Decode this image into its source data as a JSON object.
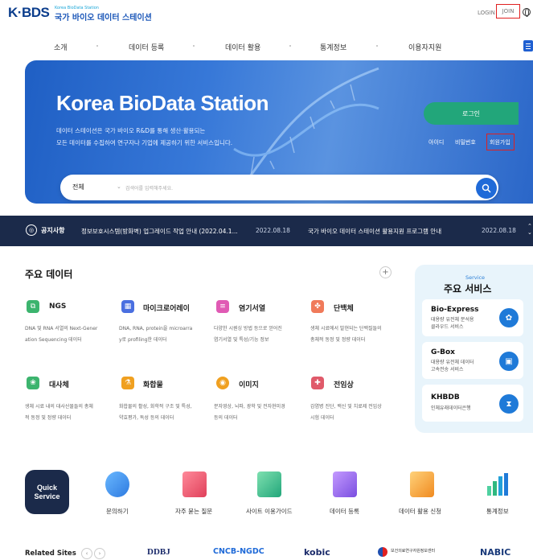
{
  "header": {
    "logo_text": "K·BDS",
    "logo_sub": "Korea BioData Station",
    "logo_name": "국가 바이오 데이터 스테이션",
    "login": "LOGIN",
    "join": "JOIN"
  },
  "nav": [
    "소개",
    "데이터 등록",
    "데이터 활용",
    "통계정보",
    "이용자지원"
  ],
  "hero": {
    "title": "Korea BioData Station",
    "desc_line1": "데이터 스테이션은 국가 바이오 R&D를 통해 생산·활용되는",
    "desc_line2": "모든 데이터를 수집하여 연구자나 기업에 제공하기 위한 서비스입니다.",
    "login_button": "로그인",
    "find_id": "아이디",
    "find_pw": "비밀번호",
    "signup": "회원가입"
  },
  "search": {
    "category": "전체",
    "placeholder": "검색어를 입력해주세요."
  },
  "notice": {
    "label": "공지사항",
    "items": [
      {
        "text": "정보보호시스템(방화벽) 업그레이드 작업 안내 (2022.04.1...",
        "date": "2022.08.18"
      },
      {
        "text": "국가 바이오 데이터 스테이션 활용지원 프로그램 안내",
        "date": "2022.08.18"
      }
    ]
  },
  "main_data": {
    "title": "주요 데이터",
    "items": [
      {
        "name": "NGS",
        "desc1": "DNA 및 RNA 서열의 Next-Gener",
        "desc2": "ation Sequencing 데이터",
        "color": "#3cb46e"
      },
      {
        "name": "마이크로어레이",
        "desc1": "DNA, RNA, protein을 microarra",
        "desc2": "y로 profiling한 데이터",
        "color": "#4a6fe0"
      },
      {
        "name": "염기서열",
        "desc1": "다양한 시퀀싱 방법 등으로 얻어진",
        "desc2": "염기서열 및 특성/기능 정보",
        "color": "#e05ab4"
      },
      {
        "name": "단백체",
        "desc1": "생체 시료에서 발현되는 단백질들의",
        "desc2": "총체적 동정 및 정량 데이터",
        "color": "#f07a5a"
      },
      {
        "name": "대사체",
        "desc1": "생체 시료 내의 대사산물들의 총체",
        "desc2": "적 동정 및 정량 데이터",
        "color": "#3cb46e"
      },
      {
        "name": "화합물",
        "desc1": "화합물의 활성, 화학적 구조 및 특성,",
        "desc2": "약효평가, 독성 등의 데이터",
        "color": "#f0a020"
      },
      {
        "name": "이미지",
        "desc1": "분자영상, 뇌파, 광학 및 전자현미경",
        "desc2": "등의 데이터",
        "color": "#f0a020"
      },
      {
        "name": "전임상",
        "desc1": "감염병 진단, 백신 및 치료제 전임상",
        "desc2": "시험 데이터",
        "color": "#e05a6a"
      }
    ]
  },
  "services": {
    "sub": "Service",
    "title": "주요 서비스",
    "items": [
      {
        "name": "Bio-Express",
        "desc1": "대용량 유전체 분석용",
        "desc2": "클라우드 서비스",
        "color": "#1f7ad8"
      },
      {
        "name": "G-Box",
        "desc1": "대용량 유전체 데이터",
        "desc2": "고속전송 서비스",
        "color": "#1f7ad8"
      },
      {
        "name": "KHBDB",
        "desc1": "인체유래데이터은행",
        "desc2": "",
        "color": "#1f7ad8"
      }
    ]
  },
  "quick": {
    "label_line1": "Quick",
    "label_line2": "Service",
    "items": [
      "문의하기",
      "자주 묻는 질문",
      "사이트 이용가이드",
      "데이터 등록",
      "데이터 활용 신청",
      "통계정보"
    ]
  },
  "related": {
    "label": "Related Sites",
    "sites": [
      "DDBJ",
      "CNCB-NGDC",
      "kobic",
      "보건의료연구자원정보센터",
      "NABIC"
    ]
  }
}
